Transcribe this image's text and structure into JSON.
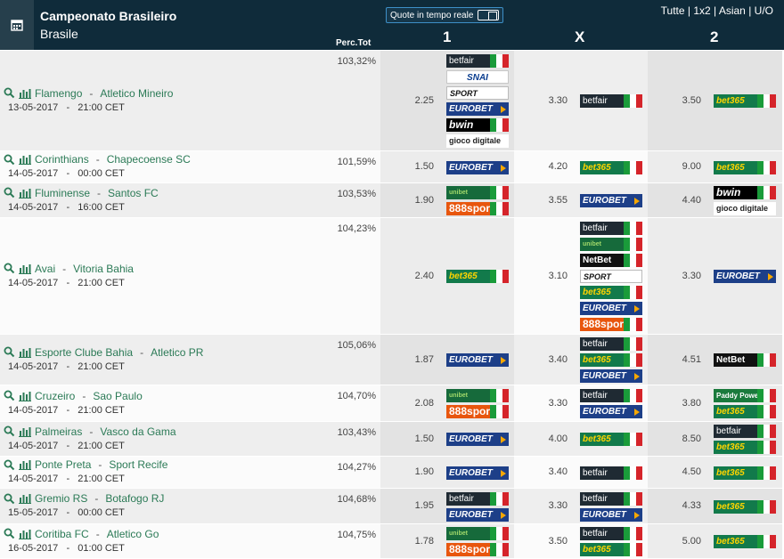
{
  "header": {
    "title": "Campeonato Brasileiro",
    "subtitle": "Brasile",
    "live_toggle_label": "Quote in tempo reale",
    "markets": [
      "Tutte",
      "1x2",
      "Asian",
      "U/O"
    ],
    "perc_label": "Perc.Tot",
    "col1": "1",
    "colx": "X",
    "col2": "2"
  },
  "colors": {
    "header_bg": "#0f2b3a",
    "team_link": "#2b7a56"
  },
  "rows": [
    {
      "home": "Flamengo",
      "away": "Atletico Mineiro",
      "date": "13-05-2017",
      "time": "21:00 CET",
      "perc": "103,32%",
      "o1": "2.25",
      "ox": "3.30",
      "o2": "3.50",
      "b1": [
        {
          "name": "betfair"
        },
        {
          "name": "SNAI"
        },
        {
          "name": "SPORT"
        },
        {
          "name": "EUROBET"
        },
        {
          "name": "bwin"
        },
        {
          "name": "gioco digitale"
        }
      ],
      "bx": [
        {
          "name": "betfair"
        }
      ],
      "b2": [
        {
          "name": "bet365"
        }
      ]
    },
    {
      "home": "Corinthians",
      "away": "Chapecoense SC",
      "date": "14-05-2017",
      "time": "00:00 CET",
      "perc": "101,59%",
      "o1": "1.50",
      "ox": "4.20",
      "o2": "9.00",
      "b1": [
        {
          "name": "EUROBET"
        }
      ],
      "bx": [
        {
          "name": "bet365"
        }
      ],
      "b2": [
        {
          "name": "bet365"
        }
      ]
    },
    {
      "home": "Fluminense",
      "away": "Santos FC",
      "date": "14-05-2017",
      "time": "16:00 CET",
      "perc": "103,53%",
      "o1": "1.90",
      "ox": "3.55",
      "o2": "4.40",
      "b1": [
        {
          "name": "unibet"
        },
        {
          "name": "888sport.it"
        }
      ],
      "bx": [
        {
          "name": "EUROBET"
        }
      ],
      "b2": [
        {
          "name": "bwin"
        },
        {
          "name": "gioco digitale"
        }
      ]
    },
    {
      "home": "Avai",
      "away": "Vitoria Bahia",
      "date": "14-05-2017",
      "time": "21:00 CET",
      "perc": "104,23%",
      "o1": "2.40",
      "ox": "3.10",
      "o2": "3.30",
      "b1": [
        {
          "name": "bet365"
        }
      ],
      "bx": [
        {
          "name": "betfair"
        },
        {
          "name": "unibet"
        },
        {
          "name": "NetBet"
        },
        {
          "name": "SPORT"
        },
        {
          "name": "bet365"
        },
        {
          "name": "EUROBET"
        },
        {
          "name": "888sport.it"
        }
      ],
      "b2": [
        {
          "name": "EUROBET"
        }
      ]
    },
    {
      "home": "Esporte Clube Bahia",
      "away": "Atletico PR",
      "date": "14-05-2017",
      "time": "21:00 CET",
      "perc": "105,06%",
      "o1": "1.87",
      "ox": "3.40",
      "o2": "4.51",
      "b1": [
        {
          "name": "EUROBET"
        }
      ],
      "bx": [
        {
          "name": "betfair"
        },
        {
          "name": "bet365"
        },
        {
          "name": "EUROBET"
        }
      ],
      "b2": [
        {
          "name": "NetBet"
        }
      ]
    },
    {
      "home": "Cruzeiro",
      "away": "Sao Paulo",
      "date": "14-05-2017",
      "time": "21:00 CET",
      "perc": "104,70%",
      "o1": "2.08",
      "ox": "3.30",
      "o2": "3.80",
      "b1": [
        {
          "name": "unibet"
        },
        {
          "name": "888sport.it"
        }
      ],
      "bx": [
        {
          "name": "betfair"
        },
        {
          "name": "EUROBET"
        }
      ],
      "b2": [
        {
          "name": "Paddy Power"
        },
        {
          "name": "bet365"
        }
      ]
    },
    {
      "home": "Palmeiras",
      "away": "Vasco da Gama",
      "date": "14-05-2017",
      "time": "21:00 CET",
      "perc": "103,43%",
      "o1": "1.50",
      "ox": "4.00",
      "o2": "8.50",
      "b1": [
        {
          "name": "EUROBET"
        }
      ],
      "bx": [
        {
          "name": "bet365"
        }
      ],
      "b2": [
        {
          "name": "betfair"
        },
        {
          "name": "bet365"
        }
      ]
    },
    {
      "home": "Ponte Preta",
      "away": "Sport Recife",
      "date": "14-05-2017",
      "time": "21:00 CET",
      "perc": "104,27%",
      "o1": "1.90",
      "ox": "3.40",
      "o2": "4.50",
      "b1": [
        {
          "name": "EUROBET"
        }
      ],
      "bx": [
        {
          "name": "betfair"
        }
      ],
      "b2": [
        {
          "name": "bet365"
        }
      ]
    },
    {
      "home": "Gremio RS",
      "away": "Botafogo RJ",
      "date": "15-05-2017",
      "time": "00:00 CET",
      "perc": "104,68%",
      "o1": "1.95",
      "ox": "3.30",
      "o2": "4.33",
      "b1": [
        {
          "name": "betfair"
        },
        {
          "name": "EUROBET"
        }
      ],
      "bx": [
        {
          "name": "betfair"
        },
        {
          "name": "EUROBET"
        }
      ],
      "b2": [
        {
          "name": "bet365"
        }
      ]
    },
    {
      "home": "Coritiba FC",
      "away": "Atletico Go",
      "date": "16-05-2017",
      "time": "01:00 CET",
      "perc": "104,75%",
      "o1": "1.78",
      "ox": "3.50",
      "o2": "5.00",
      "b1": [
        {
          "name": "unibet"
        },
        {
          "name": "888sport.it"
        }
      ],
      "bx": [
        {
          "name": "betfair"
        },
        {
          "name": "bet365"
        }
      ],
      "b2": [
        {
          "name": "bet365"
        }
      ]
    }
  ]
}
